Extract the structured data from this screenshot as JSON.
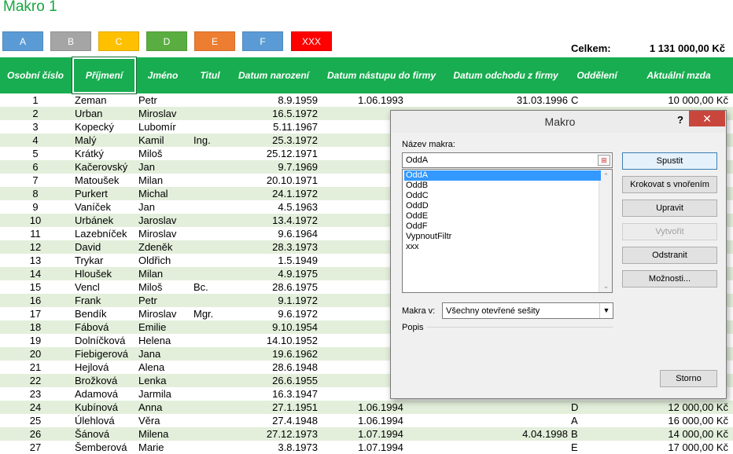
{
  "page_title": "Makro 1",
  "macro_buttons": [
    {
      "label": "A",
      "color": "#5b9bd5"
    },
    {
      "label": "B",
      "color": "#a5a5a5"
    },
    {
      "label": "C",
      "color": "#ffc000"
    },
    {
      "label": "D",
      "color": "#5aad40"
    },
    {
      "label": "E",
      "color": "#ed7d31"
    },
    {
      "label": "F",
      "color": "#5b9bd5"
    },
    {
      "label": "XXX",
      "color": "#ff0000"
    }
  ],
  "total": {
    "label": "Celkem:",
    "value": "1 131 000,00 Kč"
  },
  "headers": [
    "Osobní číslo",
    "Příjmení",
    "Jméno",
    "Titul",
    "Datum narození",
    "Datum nástupu do firmy",
    "Datum odchodu z firmy",
    "Oddělení",
    "Aktuální mzda"
  ],
  "rows": [
    [
      "1",
      "Zeman",
      "Petr",
      "",
      "8.9.1959",
      "1.06.1993",
      "31.03.1996",
      "C",
      "10 000,00 Kč"
    ],
    [
      "2",
      "Urban",
      "Miroslav",
      "",
      "16.5.1972",
      "",
      "",
      "",
      ""
    ],
    [
      "3",
      "Kopecký",
      "Lubomír",
      "",
      "5.11.1967",
      "",
      "",
      "",
      ""
    ],
    [
      "4",
      "Malý",
      "Kamil",
      "Ing.",
      "25.3.1972",
      "",
      "",
      "",
      ""
    ],
    [
      "5",
      "Krátký",
      "Miloš",
      "",
      "25.12.1971",
      "",
      "",
      "",
      ""
    ],
    [
      "6",
      "Kačerovský",
      "Jan",
      "",
      "9.7.1969",
      "",
      "",
      "",
      ""
    ],
    [
      "7",
      "Matoušek",
      "Milan",
      "",
      "20.10.1971",
      "",
      "",
      "",
      ""
    ],
    [
      "8",
      "Purkert",
      "Michal",
      "",
      "24.1.1972",
      "",
      "",
      "",
      ""
    ],
    [
      "9",
      "Vaníček",
      "Jan",
      "",
      "4.5.1963",
      "",
      "",
      "",
      ""
    ],
    [
      "10",
      "Urbánek",
      "Jaroslav",
      "",
      "13.4.1972",
      "",
      "",
      "",
      ""
    ],
    [
      "11",
      "Lazebníček",
      "Miroslav",
      "",
      "9.6.1964",
      "",
      "",
      "",
      ""
    ],
    [
      "12",
      "David",
      "Zdeněk",
      "",
      "28.3.1973",
      "",
      "",
      "",
      ""
    ],
    [
      "13",
      "Trykar",
      "Oldřich",
      "",
      "1.5.1949",
      "",
      "",
      "",
      ""
    ],
    [
      "14",
      "Hloušek",
      "Milan",
      "",
      "4.9.1975",
      "",
      "",
      "",
      ""
    ],
    [
      "15",
      "Vencl",
      "Miloš",
      "Bc.",
      "28.6.1975",
      "",
      "",
      "",
      ""
    ],
    [
      "16",
      "Frank",
      "Petr",
      "",
      "9.1.1972",
      "",
      "",
      "",
      ""
    ],
    [
      "17",
      "Bendík",
      "Miroslav",
      "Mgr.",
      "9.6.1972",
      "",
      "",
      "",
      ""
    ],
    [
      "18",
      "Fábová",
      "Emilie",
      "",
      "9.10.1954",
      "",
      "",
      "",
      ""
    ],
    [
      "19",
      "Dolníčková",
      "Helena",
      "",
      "14.10.1952",
      "",
      "",
      "",
      ""
    ],
    [
      "20",
      "Fiebigerová",
      "Jana",
      "",
      "19.6.1962",
      "",
      "",
      "",
      ""
    ],
    [
      "21",
      "Hejlová",
      "Alena",
      "",
      "28.6.1948",
      "",
      "",
      "",
      ""
    ],
    [
      "22",
      "Brožková",
      "Lenka",
      "",
      "26.6.1955",
      "",
      "",
      "",
      ""
    ],
    [
      "23",
      "Adamová",
      "Jarmila",
      "",
      "16.3.1947",
      "",
      "",
      "",
      ""
    ],
    [
      "24",
      "Kubínová",
      "Anna",
      "",
      "27.1.1951",
      "1.06.1994",
      "",
      "D",
      "12 000,00 Kč"
    ],
    [
      "25",
      "Úlehlová",
      "Věra",
      "",
      "27.4.1948",
      "1.06.1994",
      "",
      "A",
      "16 000,00 Kč"
    ],
    [
      "26",
      "Šánová",
      "Milena",
      "",
      "27.12.1973",
      "1.07.1994",
      "4.04.1998",
      "B",
      "14 000,00 Kč"
    ],
    [
      "27",
      "Šemberová",
      "Marie",
      "",
      "3.8.1973",
      "1.07.1994",
      "",
      "E",
      "17 000,00 Kč"
    ]
  ],
  "dialog": {
    "title": "Makro",
    "help": "?",
    "close": "✕",
    "name_label": "Název makra:",
    "name_value": "OddA",
    "macros": [
      "OddA",
      "OddB",
      "OddC",
      "OddD",
      "OddE",
      "OddF",
      "VypnoutFiltr",
      "xxx"
    ],
    "selected_macro": "OddA",
    "macros_in_label": "Makra v:",
    "macros_in_value": "Všechny otevřené sešity",
    "description_label": "Popis",
    "buttons": {
      "run": "Spustit",
      "step_into": "Krokovat s vnořením",
      "edit": "Upravit",
      "create": "Vytvořit",
      "delete": "Odstranit",
      "options": "Možnosti...",
      "cancel": "Storno"
    }
  }
}
